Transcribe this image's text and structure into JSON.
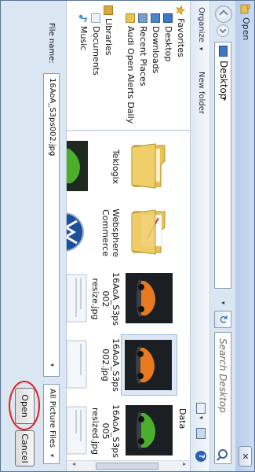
{
  "window": {
    "title": "Open",
    "close_symbol": "✕"
  },
  "address_bar": {
    "location": "Desktop",
    "separator": "▸",
    "dropdown_symbol": "▾",
    "refresh_symbol": "↻"
  },
  "search": {
    "placeholder": "Search Desktop"
  },
  "toolbar": {
    "organize_label": "Organize",
    "organize_arrow": "▾",
    "new_folder_label": "New folder",
    "view_arrow": "▾",
    "help_symbol": "?"
  },
  "nav_pane": {
    "items": [
      {
        "label": "Favorites",
        "icon": "star-icon",
        "color": "#f0b429"
      },
      {
        "label": "Desktop",
        "icon": "desktop-icon",
        "color": "#3b78c4"
      },
      {
        "label": "Downloads",
        "icon": "downloads-folder-icon",
        "color": "#4a86c8"
      },
      {
        "label": "Recent Places",
        "icon": "recent-places-icon",
        "color": "#7a9cc6"
      },
      {
        "label": "Audi Open Alerts Daily",
        "icon": "folder-icon",
        "color": "#e8c252"
      },
      {
        "label": "Libraries",
        "icon": "libraries-icon",
        "color": "#d9a93a"
      },
      {
        "label": "Documents",
        "icon": "documents-icon",
        "color": "#8aa9cf"
      },
      {
        "label": "Music",
        "icon": "music-icon",
        "color": "#3c8fd8"
      }
    ],
    "scroll_left": "◂",
    "scroll_right": "▸",
    "scroll_grip": "|||"
  },
  "content": {
    "group_header": "Data",
    "items": [
      {
        "caption_1": "Teklogix",
        "caption_2": "",
        "caption_3": "",
        "kind": "folder"
      },
      {
        "caption_1": "Websphere",
        "caption_2": "Commerce",
        "caption_3": "",
        "kind": "folder"
      },
      {
        "caption_1": "16AoA_S3ps",
        "caption_2": "002",
        "caption_3": "resize.jpg",
        "kind": "image-orange-car"
      },
      {
        "caption_1": "16AoA_S3ps",
        "caption_2": "002.jpg",
        "caption_3": "",
        "kind": "image-orange-car",
        "selected": true
      },
      {
        "caption_1": "16AoA_S3ps",
        "caption_2": "005",
        "caption_3": "resized.jpg",
        "kind": "image-green-car"
      },
      {
        "caption_1": "",
        "caption_2": "",
        "caption_3": "",
        "kind": "image-green-car"
      },
      {
        "caption_1": "",
        "caption_2": "",
        "caption_3": "",
        "kind": "image-vw-logo"
      },
      {
        "caption_1": "",
        "caption_2": "",
        "caption_3": "",
        "kind": "image-document"
      },
      {
        "caption_1": "",
        "caption_2": "",
        "caption_3": "",
        "kind": "image-document"
      },
      {
        "caption_1": "",
        "caption_2": "",
        "caption_3": "",
        "kind": "image-document"
      }
    ],
    "scroll_up": "▴",
    "scroll_down": "▾"
  },
  "bottom": {
    "file_name_label": "File name:",
    "file_name_value": "16AoA_S3ps002.jpg",
    "file_name_drop": "▾",
    "file_type_value": "All Picture Files",
    "file_type_drop": "▾",
    "open_label": "Open",
    "cancel_label": "Cancel"
  },
  "colors": {
    "annotation": "#e02020",
    "selection": "#dce8f6"
  }
}
